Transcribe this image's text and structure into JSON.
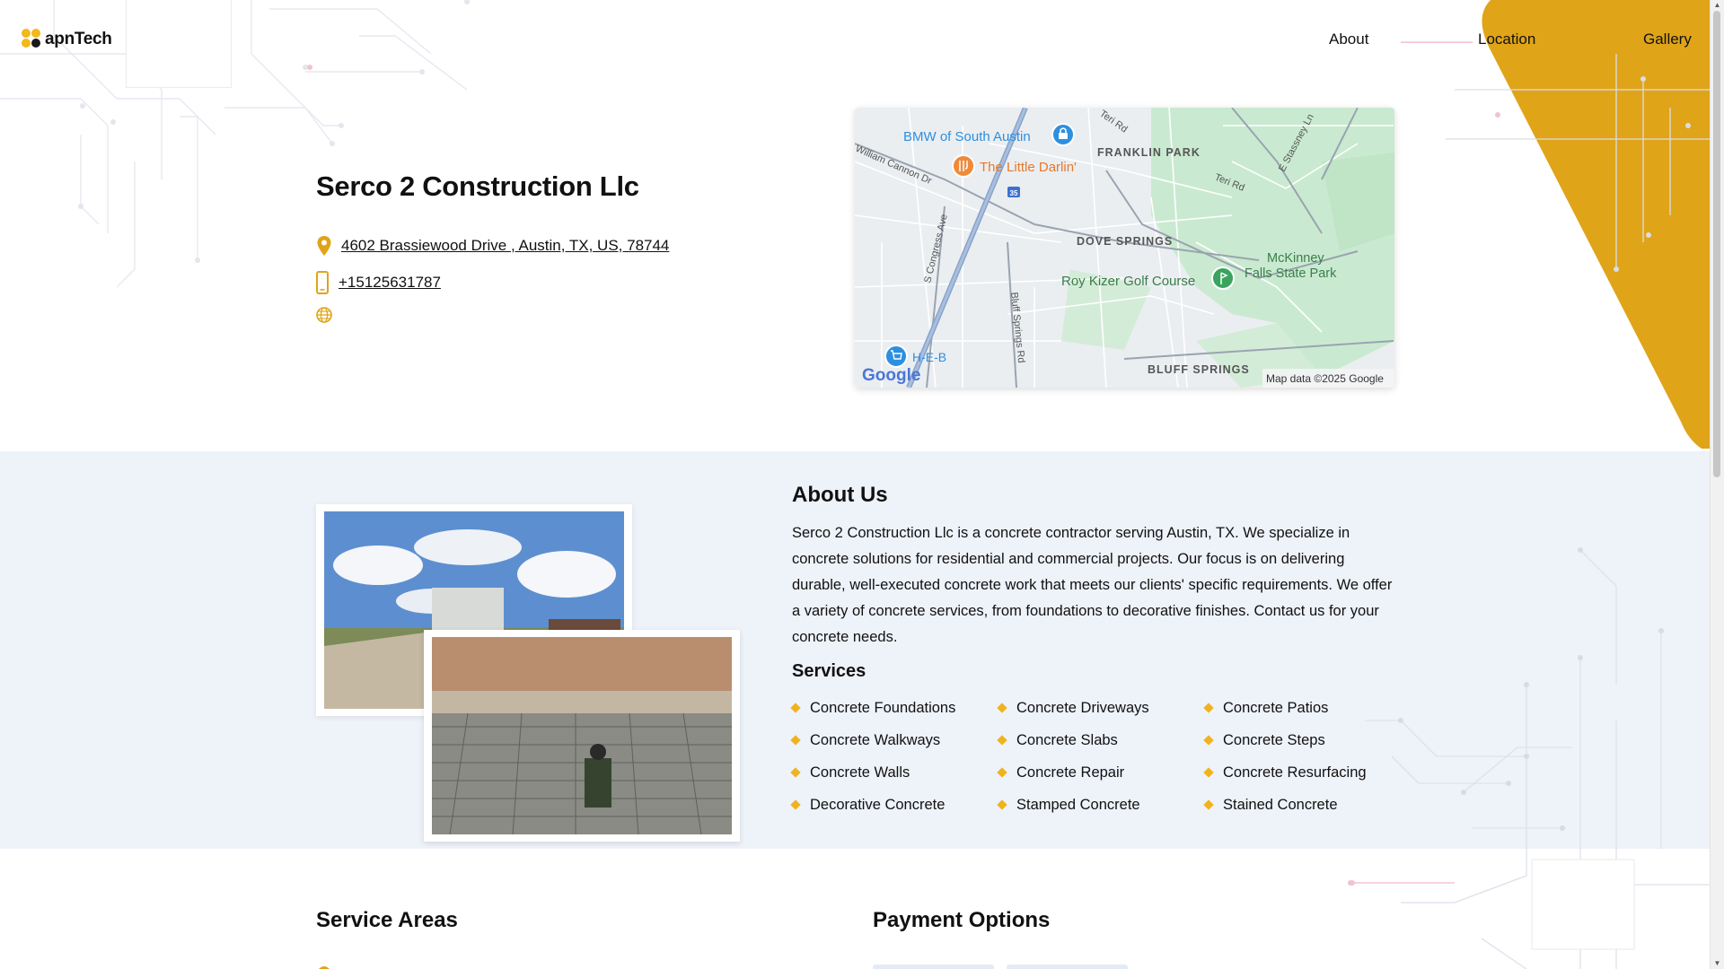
{
  "header": {
    "logo_text": "apnTech",
    "logo_dot_colors": [
      "#f3b819",
      "#f3b819",
      "#f3b819",
      "#1a1a1a"
    ],
    "nav": {
      "about": "About",
      "location": "Location",
      "gallery": "Gallery"
    }
  },
  "business": {
    "name": "Serco 2 Construction Llc",
    "address": "4602 Brassiewood Drive , Austin, TX, US, 78744",
    "phone": "+15125631787"
  },
  "map": {
    "labels": {
      "bmw": "BMW of South Austin",
      "little_darlin": "The Little Darlin'",
      "franklin_park": "FRANKLIN PARK",
      "dove_springs": "DOVE SPRINGS",
      "mckinney_1": "McKinney",
      "mckinney_2": "Falls State Park",
      "roy_kizer": "Roy Kizer Golf Course",
      "heb": "H-E-B",
      "bluff_springs": "BLUFF SPRINGS",
      "william_cannon": "William Cannon Dr",
      "teri_rd": "Teri Rd",
      "teri_rd_2": "Teri Rd",
      "stassney": "E Stassney Ln",
      "congress": "S Congress Ave",
      "bluff_springs_rd": "Bluff Springs Rd",
      "i35": "35",
      "google": "Google",
      "copyright": "Map data ©2025 Google"
    }
  },
  "about": {
    "title": "About Us",
    "body": "Serco 2 Construction Llc is a concrete contractor serving Austin, TX. We specialize in concrete solutions for residential and commercial projects. Our focus is on delivering durable, well-executed concrete work that meets our clients' specific requirements. We offer a variety of concrete services, from foundations to decorative finishes. Contact us for your concrete needs."
  },
  "services": {
    "title": "Services",
    "items": [
      "Concrete Foundations",
      "Concrete Driveways",
      "Concrete Patios",
      "Concrete Walkways",
      "Concrete Slabs",
      "Concrete Steps",
      "Concrete Walls",
      "Concrete Repair",
      "Concrete Resurfacing",
      "Decorative Concrete",
      "Stamped Concrete",
      "Stained Concrete"
    ]
  },
  "sections": {
    "service_areas": "Service Areas",
    "payment_options": "Payment Options"
  },
  "colors": {
    "accent": "#e0a418",
    "band_bg": "#eef2f9"
  }
}
